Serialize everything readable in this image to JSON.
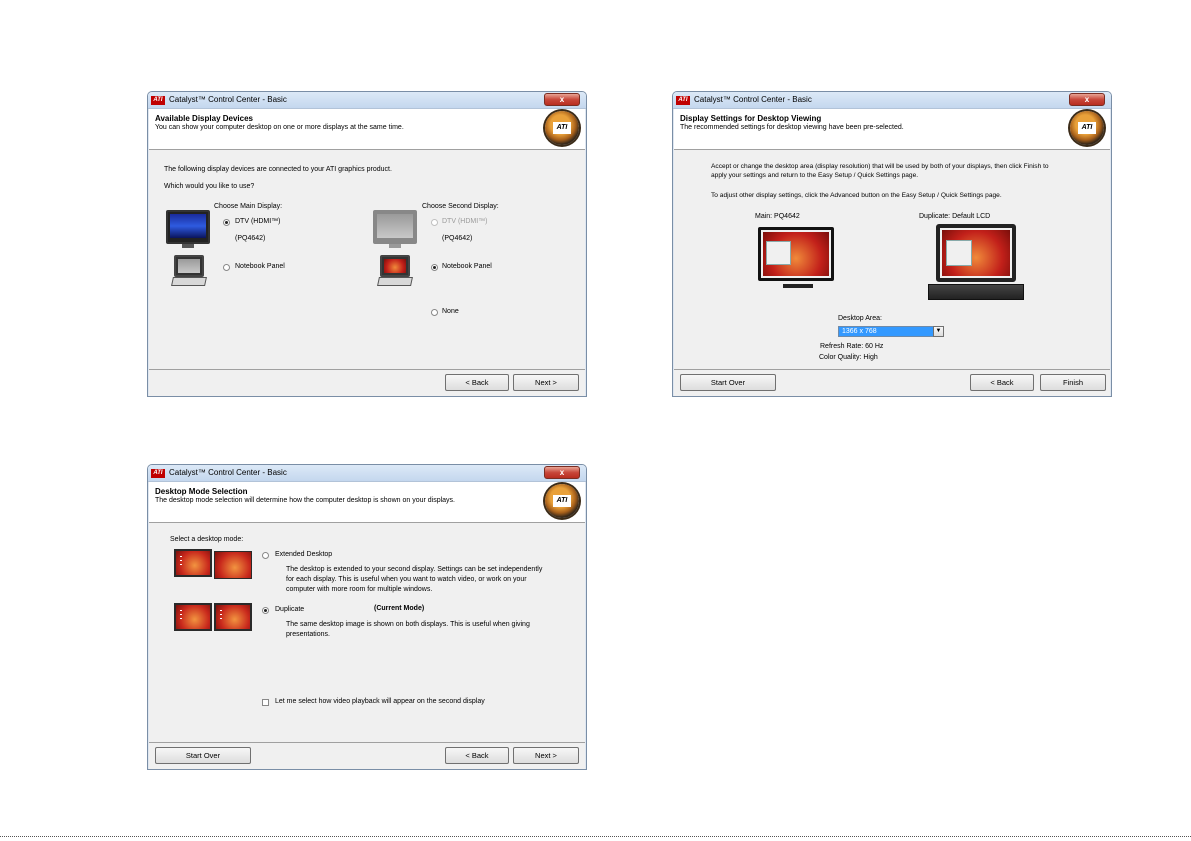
{
  "app_title": "Catalyst™ Control Center - Basic",
  "close_label": "x",
  "logo_text": "ATI",
  "dialog1": {
    "heading": "Available Display Devices",
    "subheading": "You can show your computer desktop on one or more displays at the same time.",
    "intro": "The following display devices are connected to your ATI graphics product.",
    "question": "Which would you like to use?",
    "main_label": "Choose Main Display:",
    "second_label": "Choose Second Display:",
    "main_options": [
      {
        "label": "DTV (HDMI™)",
        "sub": "(PQ4642)",
        "selected": true,
        "enabled": true
      },
      {
        "label": "Notebook Panel",
        "selected": false,
        "enabled": true
      }
    ],
    "second_options": [
      {
        "label": "DTV (HDMI™)",
        "sub": "(PQ4642)",
        "selected": false,
        "enabled": false
      },
      {
        "label": "Notebook Panel",
        "selected": true,
        "enabled": true
      },
      {
        "label": "None",
        "selected": false,
        "enabled": true
      }
    ],
    "back": "< Back",
    "next": "Next >"
  },
  "dialog2": {
    "heading": "Display Settings for Desktop Viewing",
    "subheading": "The recommended settings for desktop viewing have been pre-selected.",
    "para1_line1": "Accept or change the desktop area (display resolution) that will be used by both of your displays, then click Finish to",
    "para1_line2": "apply your settings and return to the Easy Setup / Quick Settings page.",
    "para2": "To adjust other display settings, click the Advanced button on the Easy Setup / Quick Settings page.",
    "main_caption": "Main: PQ4642",
    "duplicate_caption": "Duplicate: Default LCD",
    "desktop_area_label": "Desktop Area:",
    "desktop_area_value": "1366 x 768",
    "refresh_rate": "Refresh Rate: 60 Hz",
    "color_quality": "Color Quality: High",
    "start_over": "Start Over",
    "back": "< Back",
    "finish": "Finish"
  },
  "dialog3": {
    "heading": "Desktop Mode Selection",
    "subheading": "The desktop mode selection will determine how the computer desktop is shown on your displays.",
    "select_label": "Select a desktop mode:",
    "extended_label": "Extended Desktop",
    "extended_desc": [
      "The desktop is extended to your second display. Settings can be set independently",
      "for each display. This is useful when you want to watch video, or work on your",
      "computer with more room for multiple windows."
    ],
    "duplicate_label": "Duplicate",
    "current_mode": "(Current Mode)",
    "duplicate_desc": [
      "The same desktop image is shown on both displays. This is useful when giving",
      "presentations."
    ],
    "video_checkbox_label": "Let me select how video playback will appear on the second display",
    "start_over": "Start Over",
    "back": "< Back",
    "next": "Next >"
  }
}
